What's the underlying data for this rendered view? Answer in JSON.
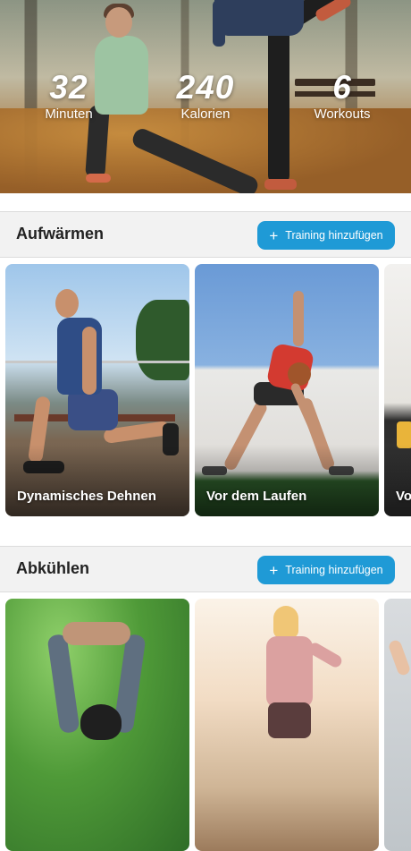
{
  "hero": {
    "stats": [
      {
        "value": "32",
        "label": "Minuten"
      },
      {
        "value": "240",
        "label": "Kalorien"
      },
      {
        "value": "6",
        "label": "Workouts"
      }
    ]
  },
  "sections": [
    {
      "title": "Aufwärmen",
      "add_button_label": "Training hinzufügen",
      "cards": [
        {
          "label": "Dynamisches Dehnen"
        },
        {
          "label": "Vor dem Laufen"
        },
        {
          "label": "Vo"
        }
      ]
    },
    {
      "title": "Abkühlen",
      "add_button_label": "Training hinzufügen",
      "cards": [
        {
          "label": ""
        },
        {
          "label": ""
        },
        {
          "label": ""
        }
      ]
    }
  ],
  "icons": {
    "add": "plus-icon"
  },
  "colors": {
    "accent": "#1f9ad6",
    "section_bg": "#f2f2f2"
  }
}
